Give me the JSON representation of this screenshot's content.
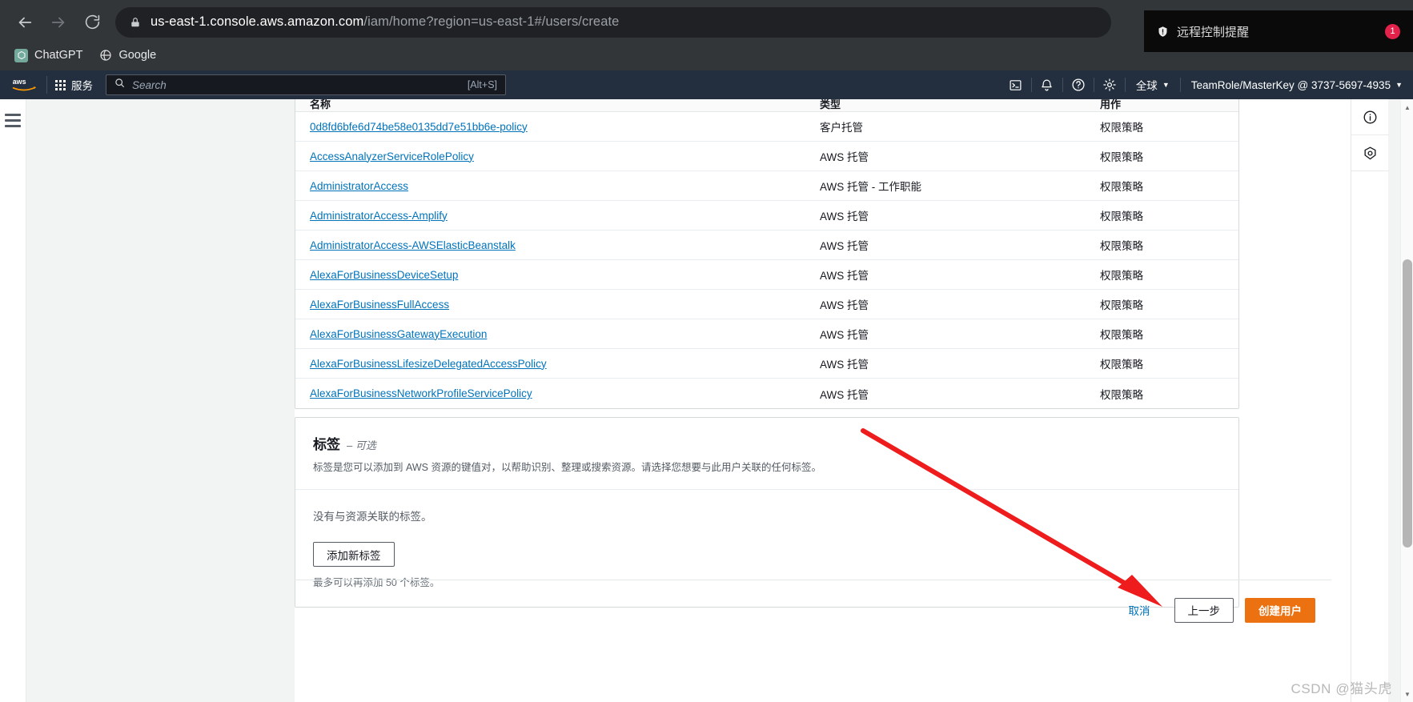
{
  "browser": {
    "back_icon": "back-arrow-icon",
    "forward_icon": "forward-arrow-icon",
    "reload_icon": "reload-icon",
    "lock_icon": "lock-icon",
    "url_domain": "us-east-1.console.aws.amazon.com",
    "url_path": "/iam/home?region=us-east-1#/users/create",
    "bookmarks": [
      {
        "label": "ChatGPT",
        "icon": "chatgpt-icon"
      },
      {
        "label": "Google",
        "icon": "google-icon"
      }
    ]
  },
  "toast": {
    "icon": "shield-alert-icon",
    "text": "远程控制提醒",
    "badge": "1"
  },
  "aws_nav": {
    "logo": "aws-logo",
    "services_label": "服务",
    "search_placeholder": "Search",
    "search_shortcut": "[Alt+S]",
    "icons": [
      {
        "name": "cloudshell-icon",
        "glyph": "cloudshell"
      },
      {
        "name": "notifications-bell-icon",
        "glyph": "bell"
      },
      {
        "name": "help-question-icon",
        "glyph": "question"
      },
      {
        "name": "settings-gear-icon",
        "glyph": "gear"
      }
    ],
    "region_label": "全球",
    "account_label": "TeamRole/MasterKey @ 3737-5697-4935"
  },
  "right_rail": [
    {
      "name": "info-panel-icon",
      "glyph": "info"
    },
    {
      "name": "security-shield-icon",
      "glyph": "shield-hex"
    }
  ],
  "policy_table": {
    "columns": [
      "名称",
      "类型",
      "用作"
    ],
    "rows": [
      {
        "name": "0d8fd6bfe6d74be58e0135dd7e51bb6e-policy",
        "type": "客户托管",
        "used_as": "权限策略"
      },
      {
        "name": "AccessAnalyzerServiceRolePolicy",
        "type": "AWS 托管",
        "used_as": "权限策略"
      },
      {
        "name": "AdministratorAccess",
        "type": "AWS 托管 - 工作职能",
        "used_as": "权限策略"
      },
      {
        "name": "AdministratorAccess-Amplify",
        "type": "AWS 托管",
        "used_as": "权限策略"
      },
      {
        "name": "AdministratorAccess-AWSElasticBeanstalk",
        "type": "AWS 托管",
        "used_as": "权限策略"
      },
      {
        "name": "AlexaForBusinessDeviceSetup",
        "type": "AWS 托管",
        "used_as": "权限策略"
      },
      {
        "name": "AlexaForBusinessFullAccess",
        "type": "AWS 托管",
        "used_as": "权限策略"
      },
      {
        "name": "AlexaForBusinessGatewayExecution",
        "type": "AWS 托管",
        "used_as": "权限策略"
      },
      {
        "name": "AlexaForBusinessLifesizeDelegatedAccessPolicy",
        "type": "AWS 托管",
        "used_as": "权限策略"
      },
      {
        "name": "AlexaForBusinessNetworkProfileServicePolicy",
        "type": "AWS 托管",
        "used_as": "权限策略"
      }
    ]
  },
  "tags": {
    "title": "标签",
    "optional": "– 可选",
    "description": "标签是您可以添加到 AWS 资源的键值对，以帮助识别、整理或搜索资源。请选择您想要与此用户关联的任何标签。",
    "empty_text": "没有与资源关联的标签。",
    "add_button": "添加新标签",
    "limit_note": "最多可以再添加 50 个标签。"
  },
  "footer": {
    "cancel": "取消",
    "previous": "上一步",
    "create": "创建用户"
  },
  "watermark": "CSDN @猫头虎",
  "colors": {
    "aws_nav_bg": "#232f3e",
    "primary_orange": "#ec7211",
    "link_blue": "#0073bb",
    "annotation_red": "#ee1c1c"
  }
}
